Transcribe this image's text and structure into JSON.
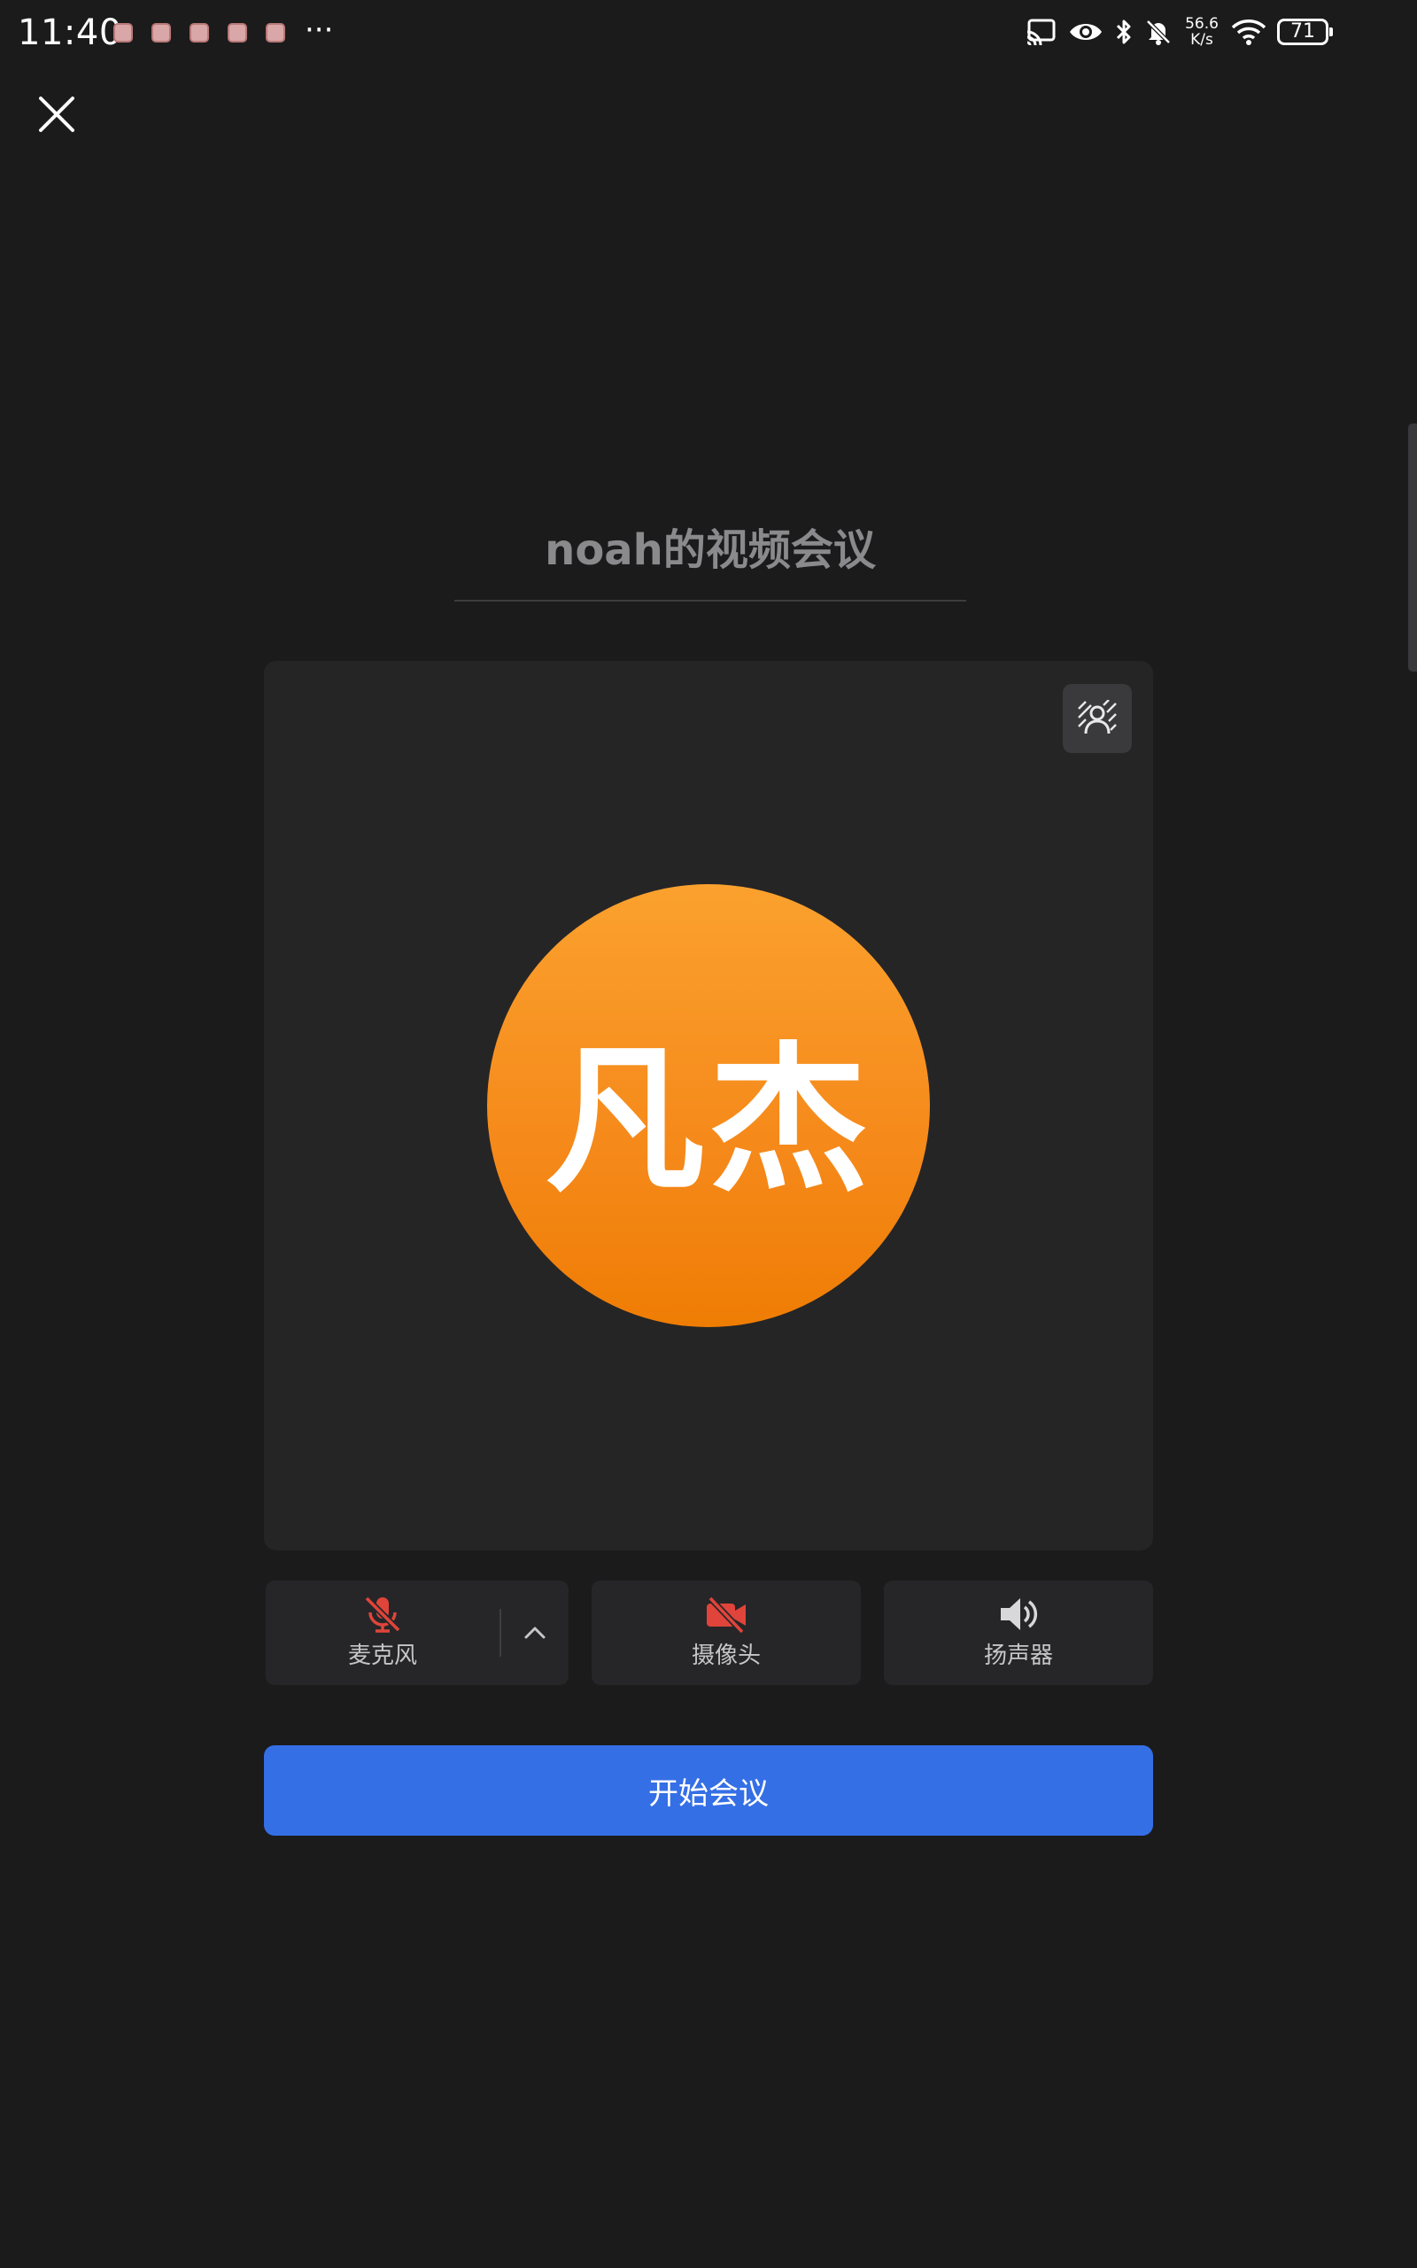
{
  "status_bar": {
    "time": "11:40",
    "more": "···",
    "net_speed_value": "56.6",
    "net_speed_unit": "K/s",
    "battery": "71",
    "icons": [
      "cast-icon",
      "eye-icon",
      "bluetooth-icon",
      "bell-off-icon",
      "wifi-icon"
    ]
  },
  "meeting": {
    "title": "noah的视频会议"
  },
  "preview": {
    "avatar_text": "凡杰",
    "avatar_color": "#f5891a"
  },
  "controls": {
    "mic_label": "麦克风",
    "camera_label": "摄像头",
    "speaker_label": "扬声器",
    "muted_color": "#e0443a"
  },
  "actions": {
    "start_label": "开始会议",
    "accent": "#356fe6"
  }
}
